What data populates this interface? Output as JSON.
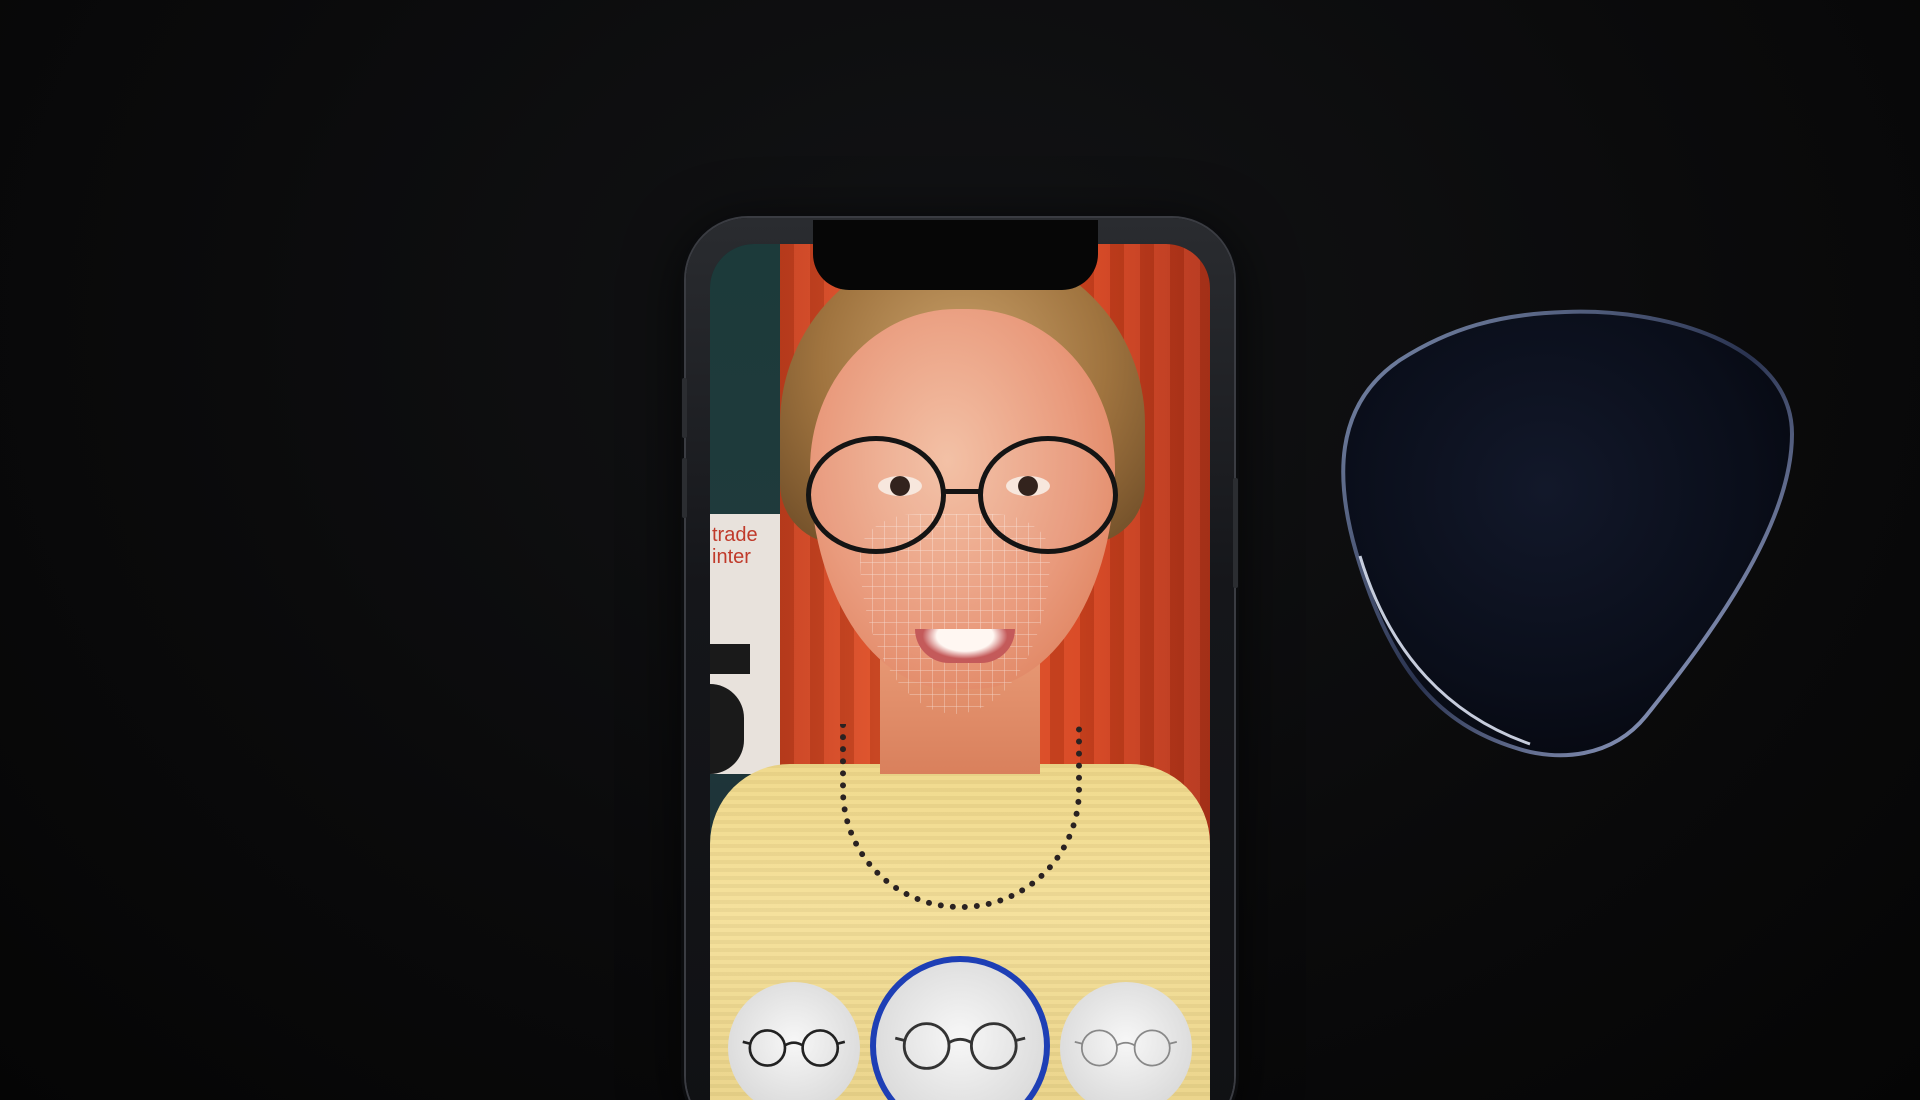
{
  "scene": {
    "poster_text": "trade\ninter"
  },
  "frame_selector": {
    "items": [
      {
        "name": "round-metal-frame-left",
        "selected": false
      },
      {
        "name": "round-metal-frame-center",
        "selected": true
      },
      {
        "name": "round-metal-frame-right",
        "selected": false
      }
    ]
  },
  "colors": {
    "background": "#0b0b0c",
    "selected_ring": "#1e3fb5",
    "curtain": "#d8451f",
    "sweater": "#f0d98a"
  }
}
